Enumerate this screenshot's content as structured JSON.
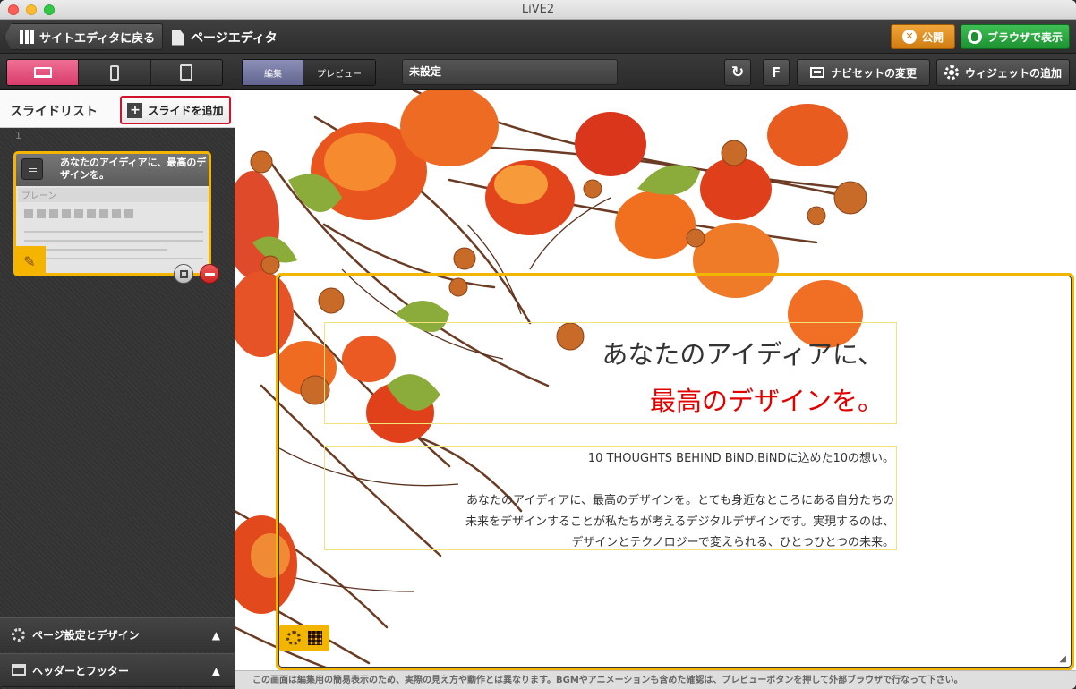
{
  "window": {
    "title": "LiVE2"
  },
  "header": {
    "back_label": "サイトエディタに戻る",
    "page_title": "ページエディタ",
    "publish_label": "公開",
    "browser_label": "ブラウザで表示"
  },
  "toolbar": {
    "devices": [
      "laptop-icon",
      "phone-icon",
      "tablet-icon"
    ],
    "active_device": "laptop",
    "edit_label": "編集",
    "preview_label": "プレビュー",
    "status_value": "未設定",
    "refresh_icon": "↻",
    "f_label": "F",
    "navi_label": "ナビセットの変更",
    "widget_label": "ウィジェットの追加"
  },
  "sidebar": {
    "title": "スライドリスト",
    "add_slide_label": "スライドを追加",
    "slides": [
      {
        "number": "1",
        "title": "あなたのアイディアに、最高のデザインを。",
        "layout": "プレーン"
      }
    ],
    "sections": [
      {
        "label": "ページ設定とデザイン",
        "icon": "gear-icon"
      },
      {
        "label": "ヘッダーとフッター",
        "icon": "header-footer-icon"
      }
    ]
  },
  "canvas": {
    "heading_line1": "あなたのアイディアに、",
    "heading_line2": "最高のデザインを。",
    "body_lines": [
      "10 THOUGHTS BEHIND BiND.BiNDに込めた10の想い。",
      "",
      "あなたのアイディアに、最高のデザインを。とても身近なところにある自分たちの",
      "未来をデザインすることが私たちが考えるデジタルデザインです。実現するのは、",
      "デザインとテクノロジーで変えられる、ひとつひとつの未来。"
    ]
  },
  "footer": {
    "notice": "この画面は編集用の簡易表示のため、実際の見え方や動作とは異なります。BGMやアニメーションも含めた確認は、プレビューボタンを押して外部ブラウザで行なって下さい。"
  },
  "colors": {
    "accent_pink": "#d83d6c",
    "publish_orange": "#d07d12",
    "browser_green": "#1d9131",
    "frame_yellow": "#f2b600",
    "heading_red": "#e00000",
    "add_slide_border": "#d0132a"
  }
}
